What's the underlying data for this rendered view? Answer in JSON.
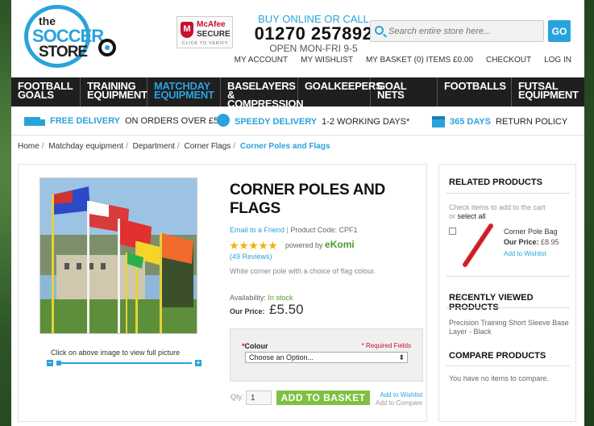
{
  "header": {
    "logo": {
      "the": "the",
      "soccer": "SOCCER",
      "store": "STORE"
    },
    "mcafee": {
      "name": "McAfee",
      "secure": "SECURE",
      "click": "CLICK TO VERIFY"
    },
    "buy_online": "BUY ONLINE OR CALL",
    "phone": "01270 257892",
    "hours": "OPEN MON-FRI 9-5",
    "search_placeholder": "Search entire store here...",
    "go_label": "GO",
    "top_links": {
      "account": "MY ACCOUNT",
      "wishlist": "MY WISHLIST",
      "basket": "MY BASKET (0) ITEMS £0.00",
      "checkout": "CHECKOUT",
      "login": "LOG IN"
    }
  },
  "nav": [
    {
      "line1": "FOOTBALL",
      "line2": "GOALS"
    },
    {
      "line1": "TRAINING",
      "line2": "EQUIPMENT"
    },
    {
      "line1": "MATCHDAY",
      "line2": "EQUIPMENT"
    },
    {
      "line1": "BASELAYERS &",
      "line2": "COMPRESSION"
    },
    {
      "line1": "GOALKEEPERS",
      "line2": ""
    },
    {
      "line1": "GOAL NETS",
      "line2": ""
    },
    {
      "line1": "FOOTBALLS",
      "line2": ""
    },
    {
      "line1": "FUTSAL",
      "line2": "EQUIPMENT"
    }
  ],
  "usp": {
    "delivery_hl": "FREE DELIVERY",
    "delivery_rest": "ON ORDERS OVER £50*",
    "speedy_hl": "SPEEDY DELIVERY",
    "speedy_rest": "1-2 WORKING DAYS*",
    "returns_hl": "365 DAYS",
    "returns_rest": "RETURN POLICY"
  },
  "breadcrumb": [
    "Home",
    "Matchday equipment",
    "Department",
    "Corner Flags"
  ],
  "breadcrumb_current": "Corner Poles and Flags",
  "product": {
    "title": "CORNER POLES AND FLAGS",
    "email_friend": "Email to a Friend",
    "code_label": "Product Code: CPF1",
    "powered_by": "powered by",
    "ekomi": "eKomi",
    "reviews": "(49 Reviews)",
    "description": "White corner pole with a choice of flag colour.",
    "availability_label": "Availability:",
    "availability_value": "In stock",
    "price_label": "Our Price:",
    "price": "£5.50",
    "zoom_hint": "Click on above image to view full picture",
    "option_label": "Colour",
    "required_note": "* Required Fields",
    "option_placeholder": "Choose an Option...",
    "qty_label": "Qty:",
    "qty_value": "1",
    "add_to_basket": "ADD TO BASKET",
    "add_to_wishlist": "Add to Wishlist",
    "add_to_compare": "Add to Compare"
  },
  "sidebar": {
    "related_title": "RELATED PRODUCTS",
    "related_hint": "Check items to add to the cart",
    "related_or": "or",
    "related_select_all": "select all",
    "related_item": {
      "name": "Corner Pole Bag",
      "price_label": "Our Price:",
      "price": "£8.95",
      "wishlist": "Add to Wishlist"
    },
    "recent_title": "RECENTLY VIEWED PRODUCTS",
    "recent_item": "Precision Training Short Sleeve Base Layer - Black",
    "compare_title": "COMPARE PRODUCTS",
    "compare_empty": "You have no items to compare."
  },
  "colors": {
    "accent": "#2aa3dc",
    "cta": "#7ec140",
    "nav_bg": "#1f1f1f",
    "required": "#c8102e"
  }
}
